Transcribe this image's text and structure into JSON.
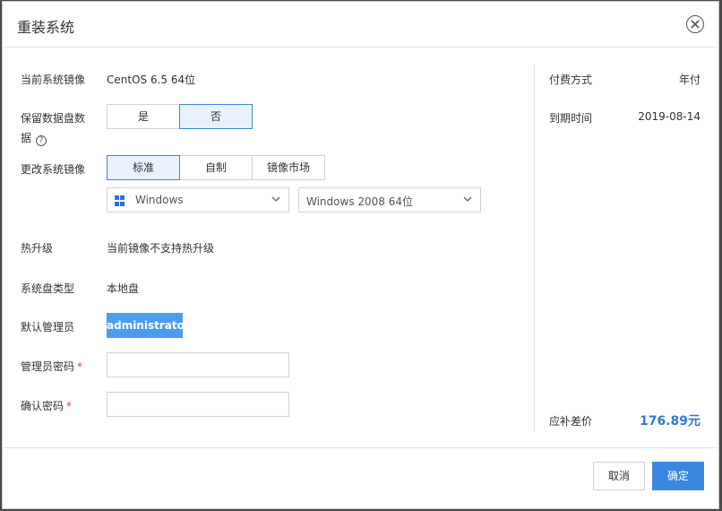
{
  "dialog": {
    "title": "重装系统",
    "close_icon": "close-circle-icon"
  },
  "form": {
    "current_image_label": "当前系统镜像",
    "current_image_value": "CentOS 6.5 64位",
    "keep_data_label_line1": "保留数据盘数",
    "keep_data_label_line2": "据",
    "keep_data_options": [
      "是",
      "否"
    ],
    "keep_data_selected": "否",
    "change_image_label": "更改系统镜像",
    "image_tabs": [
      "标准",
      "自制",
      "镜像市场"
    ],
    "image_tab_selected": "标准",
    "os_select_value": "Windows",
    "version_select_value": "Windows 2008 64位",
    "hot_upgrade_label": "热升级",
    "hot_upgrade_value": "当前镜像不支持热升级",
    "disk_type_label": "系统盘类型",
    "disk_type_value": "本地盘",
    "admin_label": "默认管理员",
    "admin_value": "administrator",
    "password_label": "管理员密码",
    "password_value": "",
    "confirm_label": "确认密码",
    "confirm_value": "",
    "required_mark": "*"
  },
  "summary": {
    "payment_label": "付费方式",
    "payment_value": "年付",
    "expiry_label": "到期时间",
    "expiry_value": "2019-08-14",
    "diff_label": "应补差价",
    "diff_value": "176.89元"
  },
  "footer": {
    "cancel_label": "取消",
    "confirm_label": "确定"
  },
  "colors": {
    "accent": "#3b86e0",
    "chip": "#4b9df1",
    "price": "#2d7ad6",
    "required": "#e4393c"
  }
}
